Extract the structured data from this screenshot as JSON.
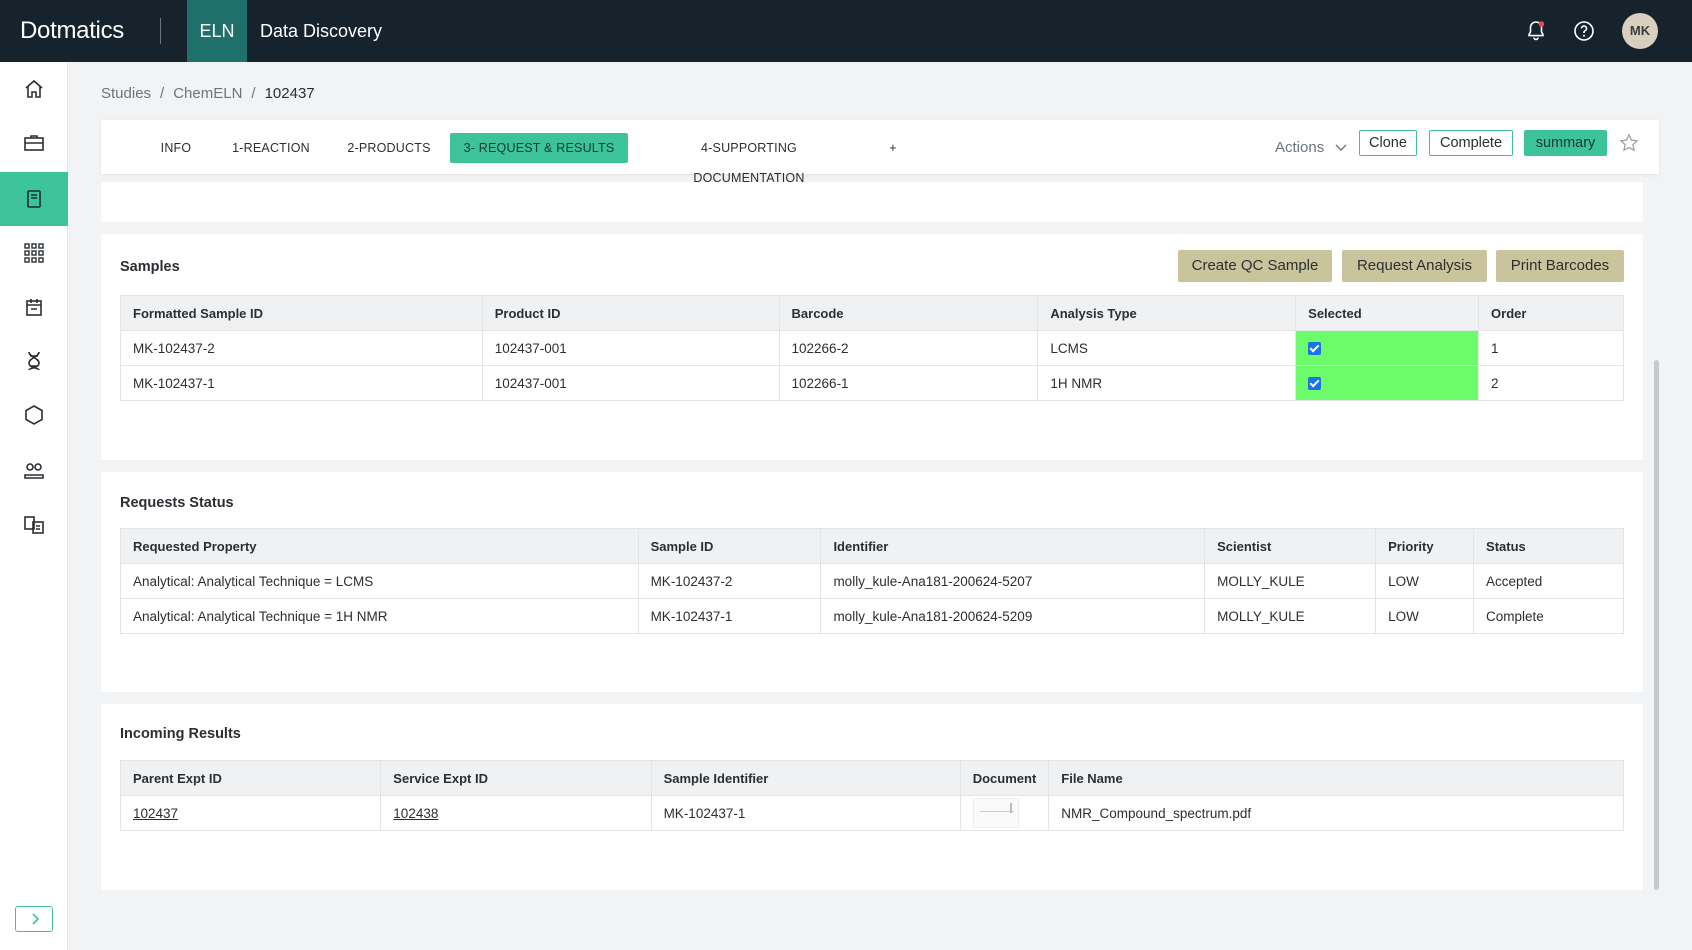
{
  "topbar": {
    "brand": "Dotmatics",
    "nav": [
      {
        "label": "ELN",
        "active": true
      },
      {
        "label": "Data Discovery",
        "active": false
      }
    ],
    "avatar_initials": "MK"
  },
  "sidebar": {
    "items": [
      {
        "icon": "home-icon",
        "active": false
      },
      {
        "icon": "briefcase-icon",
        "active": false
      },
      {
        "icon": "notebook-icon",
        "active": true
      },
      {
        "icon": "apps-grid-icon",
        "active": false
      },
      {
        "icon": "calendar-box-icon",
        "active": false
      },
      {
        "icon": "dna-icon",
        "active": false
      },
      {
        "icon": "hexagon-icon",
        "active": false
      },
      {
        "icon": "people-icon",
        "active": false
      },
      {
        "icon": "documents-icon",
        "active": false
      }
    ]
  },
  "breadcrumb": [
    "Studies",
    "ChemELN",
    "102437"
  ],
  "tabs": [
    "INFO",
    "1-REACTION",
    "2-PRODUCTS",
    "3- REQUEST & RESULTS",
    "4-SUPPORTING DOCUMENTATION",
    "+"
  ],
  "active_tab": "3- REQUEST & RESULTS",
  "toolbar": {
    "actions_label": "Actions",
    "clone_label": "Clone",
    "complete_label": "Complete",
    "summary_label": "summary"
  },
  "samples": {
    "title": "Samples",
    "buttons": [
      "Create QC Sample",
      "Request Analysis",
      "Print Barcodes"
    ],
    "columns": [
      "Formatted Sample ID",
      "Product ID",
      "Barcode",
      "Analysis Type",
      "Selected",
      "Order"
    ],
    "rows": [
      [
        "MK-102437-2",
        "102437-001",
        "102266-2",
        "LCMS",
        true,
        "1"
      ],
      [
        "MK-102437-1",
        "102437-001",
        "102266-1",
        "1H NMR",
        true,
        "2"
      ]
    ]
  },
  "requests": {
    "title": "Requests Status",
    "columns": [
      "Requested Property",
      "Sample ID",
      "Identifier",
      "Scientist",
      "Priority",
      "Status"
    ],
    "rows": [
      [
        "Analytical: Analytical Technique = LCMS",
        "MK-102437-2",
        "molly_kule-Ana181-200624-5207",
        "MOLLY_KULE",
        "LOW",
        "Accepted"
      ],
      [
        "Analytical: Analytical Technique = 1H NMR",
        "MK-102437-1",
        "molly_kule-Ana181-200624-5209",
        "MOLLY_KULE",
        "LOW",
        "Complete"
      ]
    ]
  },
  "results": {
    "title": "Incoming Results",
    "columns": [
      "Parent Expt ID",
      "Service Expt ID",
      "Sample Identifier",
      "Document",
      "File Name"
    ],
    "rows": [
      [
        "102437",
        "102438",
        "MK-102437-1",
        "",
        "NMR_Compound_spectrum.pdf"
      ]
    ]
  },
  "colors": {
    "topbar": "#16232d",
    "accent": "#3dc39a",
    "selected_cell": "#6bfb6b",
    "tan_button": "#c9c49b"
  }
}
